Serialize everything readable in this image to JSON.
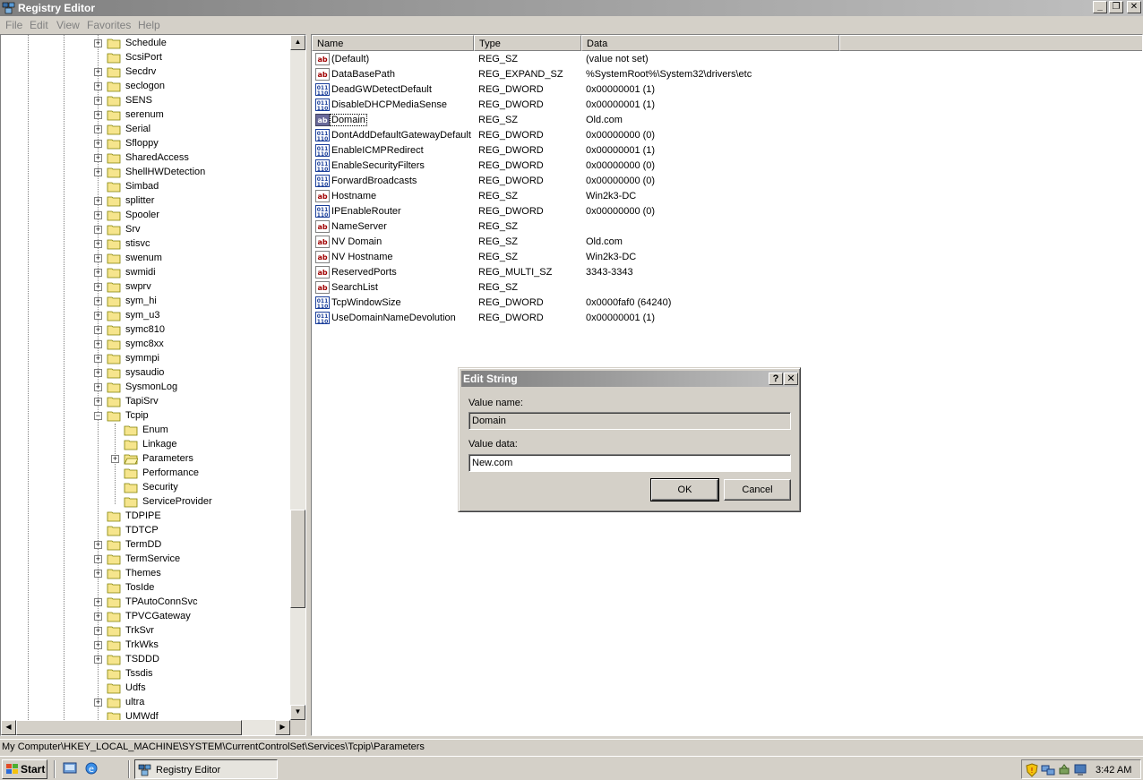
{
  "window": {
    "title": "Registry Editor"
  },
  "menu": [
    "File",
    "Edit",
    "View",
    "Favorites",
    "Help"
  ],
  "tree": {
    "items": [
      {
        "label": "Schedule",
        "level": 1,
        "expander": "+"
      },
      {
        "label": "ScsiPort",
        "level": 1,
        "expander": ""
      },
      {
        "label": "Secdrv",
        "level": 1,
        "expander": "+"
      },
      {
        "label": "seclogon",
        "level": 1,
        "expander": "+"
      },
      {
        "label": "SENS",
        "level": 1,
        "expander": "+"
      },
      {
        "label": "serenum",
        "level": 1,
        "expander": "+"
      },
      {
        "label": "Serial",
        "level": 1,
        "expander": "+"
      },
      {
        "label": "Sfloppy",
        "level": 1,
        "expander": "+"
      },
      {
        "label": "SharedAccess",
        "level": 1,
        "expander": "+"
      },
      {
        "label": "ShellHWDetection",
        "level": 1,
        "expander": "+"
      },
      {
        "label": "Simbad",
        "level": 1,
        "expander": ""
      },
      {
        "label": "splitter",
        "level": 1,
        "expander": "+"
      },
      {
        "label": "Spooler",
        "level": 1,
        "expander": "+"
      },
      {
        "label": "Srv",
        "level": 1,
        "expander": "+"
      },
      {
        "label": "stisvc",
        "level": 1,
        "expander": "+"
      },
      {
        "label": "swenum",
        "level": 1,
        "expander": "+"
      },
      {
        "label": "swmidi",
        "level": 1,
        "expander": "+"
      },
      {
        "label": "swprv",
        "level": 1,
        "expander": "+"
      },
      {
        "label": "sym_hi",
        "level": 1,
        "expander": "+"
      },
      {
        "label": "sym_u3",
        "level": 1,
        "expander": "+"
      },
      {
        "label": "symc810",
        "level": 1,
        "expander": "+"
      },
      {
        "label": "symc8xx",
        "level": 1,
        "expander": "+"
      },
      {
        "label": "symmpi",
        "level": 1,
        "expander": "+"
      },
      {
        "label": "sysaudio",
        "level": 1,
        "expander": "+"
      },
      {
        "label": "SysmonLog",
        "level": 1,
        "expander": "+"
      },
      {
        "label": "TapiSrv",
        "level": 1,
        "expander": "+"
      },
      {
        "label": "Tcpip",
        "level": 1,
        "expander": "-"
      },
      {
        "label": "Enum",
        "level": 2,
        "expander": ""
      },
      {
        "label": "Linkage",
        "level": 2,
        "expander": ""
      },
      {
        "label": "Parameters",
        "level": 2,
        "expander": "+",
        "open": true
      },
      {
        "label": "Performance",
        "level": 2,
        "expander": ""
      },
      {
        "label": "Security",
        "level": 2,
        "expander": ""
      },
      {
        "label": "ServiceProvider",
        "level": 2,
        "expander": ""
      },
      {
        "label": "TDPIPE",
        "level": 1,
        "expander": ""
      },
      {
        "label": "TDTCP",
        "level": 1,
        "expander": ""
      },
      {
        "label": "TermDD",
        "level": 1,
        "expander": "+"
      },
      {
        "label": "TermService",
        "level": 1,
        "expander": "+"
      },
      {
        "label": "Themes",
        "level": 1,
        "expander": "+"
      },
      {
        "label": "TosIde",
        "level": 1,
        "expander": ""
      },
      {
        "label": "TPAutoConnSvc",
        "level": 1,
        "expander": "+"
      },
      {
        "label": "TPVCGateway",
        "level": 1,
        "expander": "+"
      },
      {
        "label": "TrkSvr",
        "level": 1,
        "expander": "+"
      },
      {
        "label": "TrkWks",
        "level": 1,
        "expander": "+"
      },
      {
        "label": "TSDDD",
        "level": 1,
        "expander": "+"
      },
      {
        "label": "Tssdis",
        "level": 1,
        "expander": ""
      },
      {
        "label": "Udfs",
        "level": 1,
        "expander": ""
      },
      {
        "label": "ultra",
        "level": 1,
        "expander": "+"
      },
      {
        "label": "UMWdf",
        "level": 1,
        "expander": ""
      }
    ]
  },
  "list": {
    "columns": [
      "Name",
      "Type",
      "Data"
    ],
    "rows": [
      {
        "icon": "string-value-icon",
        "name": "(Default)",
        "type": "REG_SZ",
        "data": "(value not set)"
      },
      {
        "icon": "string-value-icon",
        "name": "DataBasePath",
        "type": "REG_EXPAND_SZ",
        "data": "%SystemRoot%\\System32\\drivers\\etc"
      },
      {
        "icon": "binary-value-icon",
        "name": "DeadGWDetectDefault",
        "type": "REG_DWORD",
        "data": "0x00000001 (1)"
      },
      {
        "icon": "binary-value-icon",
        "name": "DisableDHCPMediaSense",
        "type": "REG_DWORD",
        "data": "0x00000001 (1)"
      },
      {
        "icon": "string-value-icon",
        "name": "Domain",
        "type": "REG_SZ",
        "data": "Old.com",
        "selected": true
      },
      {
        "icon": "binary-value-icon",
        "name": "DontAddDefaultGatewayDefault",
        "type": "REG_DWORD",
        "data": "0x00000000 (0)"
      },
      {
        "icon": "binary-value-icon",
        "name": "EnableICMPRedirect",
        "type": "REG_DWORD",
        "data": "0x00000001 (1)"
      },
      {
        "icon": "binary-value-icon",
        "name": "EnableSecurityFilters",
        "type": "REG_DWORD",
        "data": "0x00000000 (0)"
      },
      {
        "icon": "binary-value-icon",
        "name": "ForwardBroadcasts",
        "type": "REG_DWORD",
        "data": "0x00000000 (0)"
      },
      {
        "icon": "string-value-icon",
        "name": "Hostname",
        "type": "REG_SZ",
        "data": "Win2k3-DC"
      },
      {
        "icon": "binary-value-icon",
        "name": "IPEnableRouter",
        "type": "REG_DWORD",
        "data": "0x00000000 (0)"
      },
      {
        "icon": "string-value-icon",
        "name": "NameServer",
        "type": "REG_SZ",
        "data": ""
      },
      {
        "icon": "string-value-icon",
        "name": "NV Domain",
        "type": "REG_SZ",
        "data": "Old.com"
      },
      {
        "icon": "string-value-icon",
        "name": "NV Hostname",
        "type": "REG_SZ",
        "data": "Win2k3-DC"
      },
      {
        "icon": "string-value-icon",
        "name": "ReservedPorts",
        "type": "REG_MULTI_SZ",
        "data": "3343-3343"
      },
      {
        "icon": "string-value-icon",
        "name": "SearchList",
        "type": "REG_SZ",
        "data": ""
      },
      {
        "icon": "binary-value-icon",
        "name": "TcpWindowSize",
        "type": "REG_DWORD",
        "data": "0x0000faf0 (64240)"
      },
      {
        "icon": "binary-value-icon",
        "name": "UseDomainNameDevolution",
        "type": "REG_DWORD",
        "data": "0x00000001 (1)"
      }
    ]
  },
  "dialog": {
    "title": "Edit String",
    "help_label": "?",
    "close_label": "✕",
    "value_name_label": "Value name:",
    "value_name": "Domain",
    "value_data_label": "Value data:",
    "value_data": "New.com",
    "ok_label": "OK",
    "cancel_label": "Cancel"
  },
  "statusbar": {
    "path": "My Computer\\HKEY_LOCAL_MACHINE\\SYSTEM\\CurrentControlSet\\Services\\Tcpip\\Parameters"
  },
  "taskbar": {
    "start_label": "Start",
    "task_label": "Registry Editor",
    "clock": "3:42 AM"
  }
}
